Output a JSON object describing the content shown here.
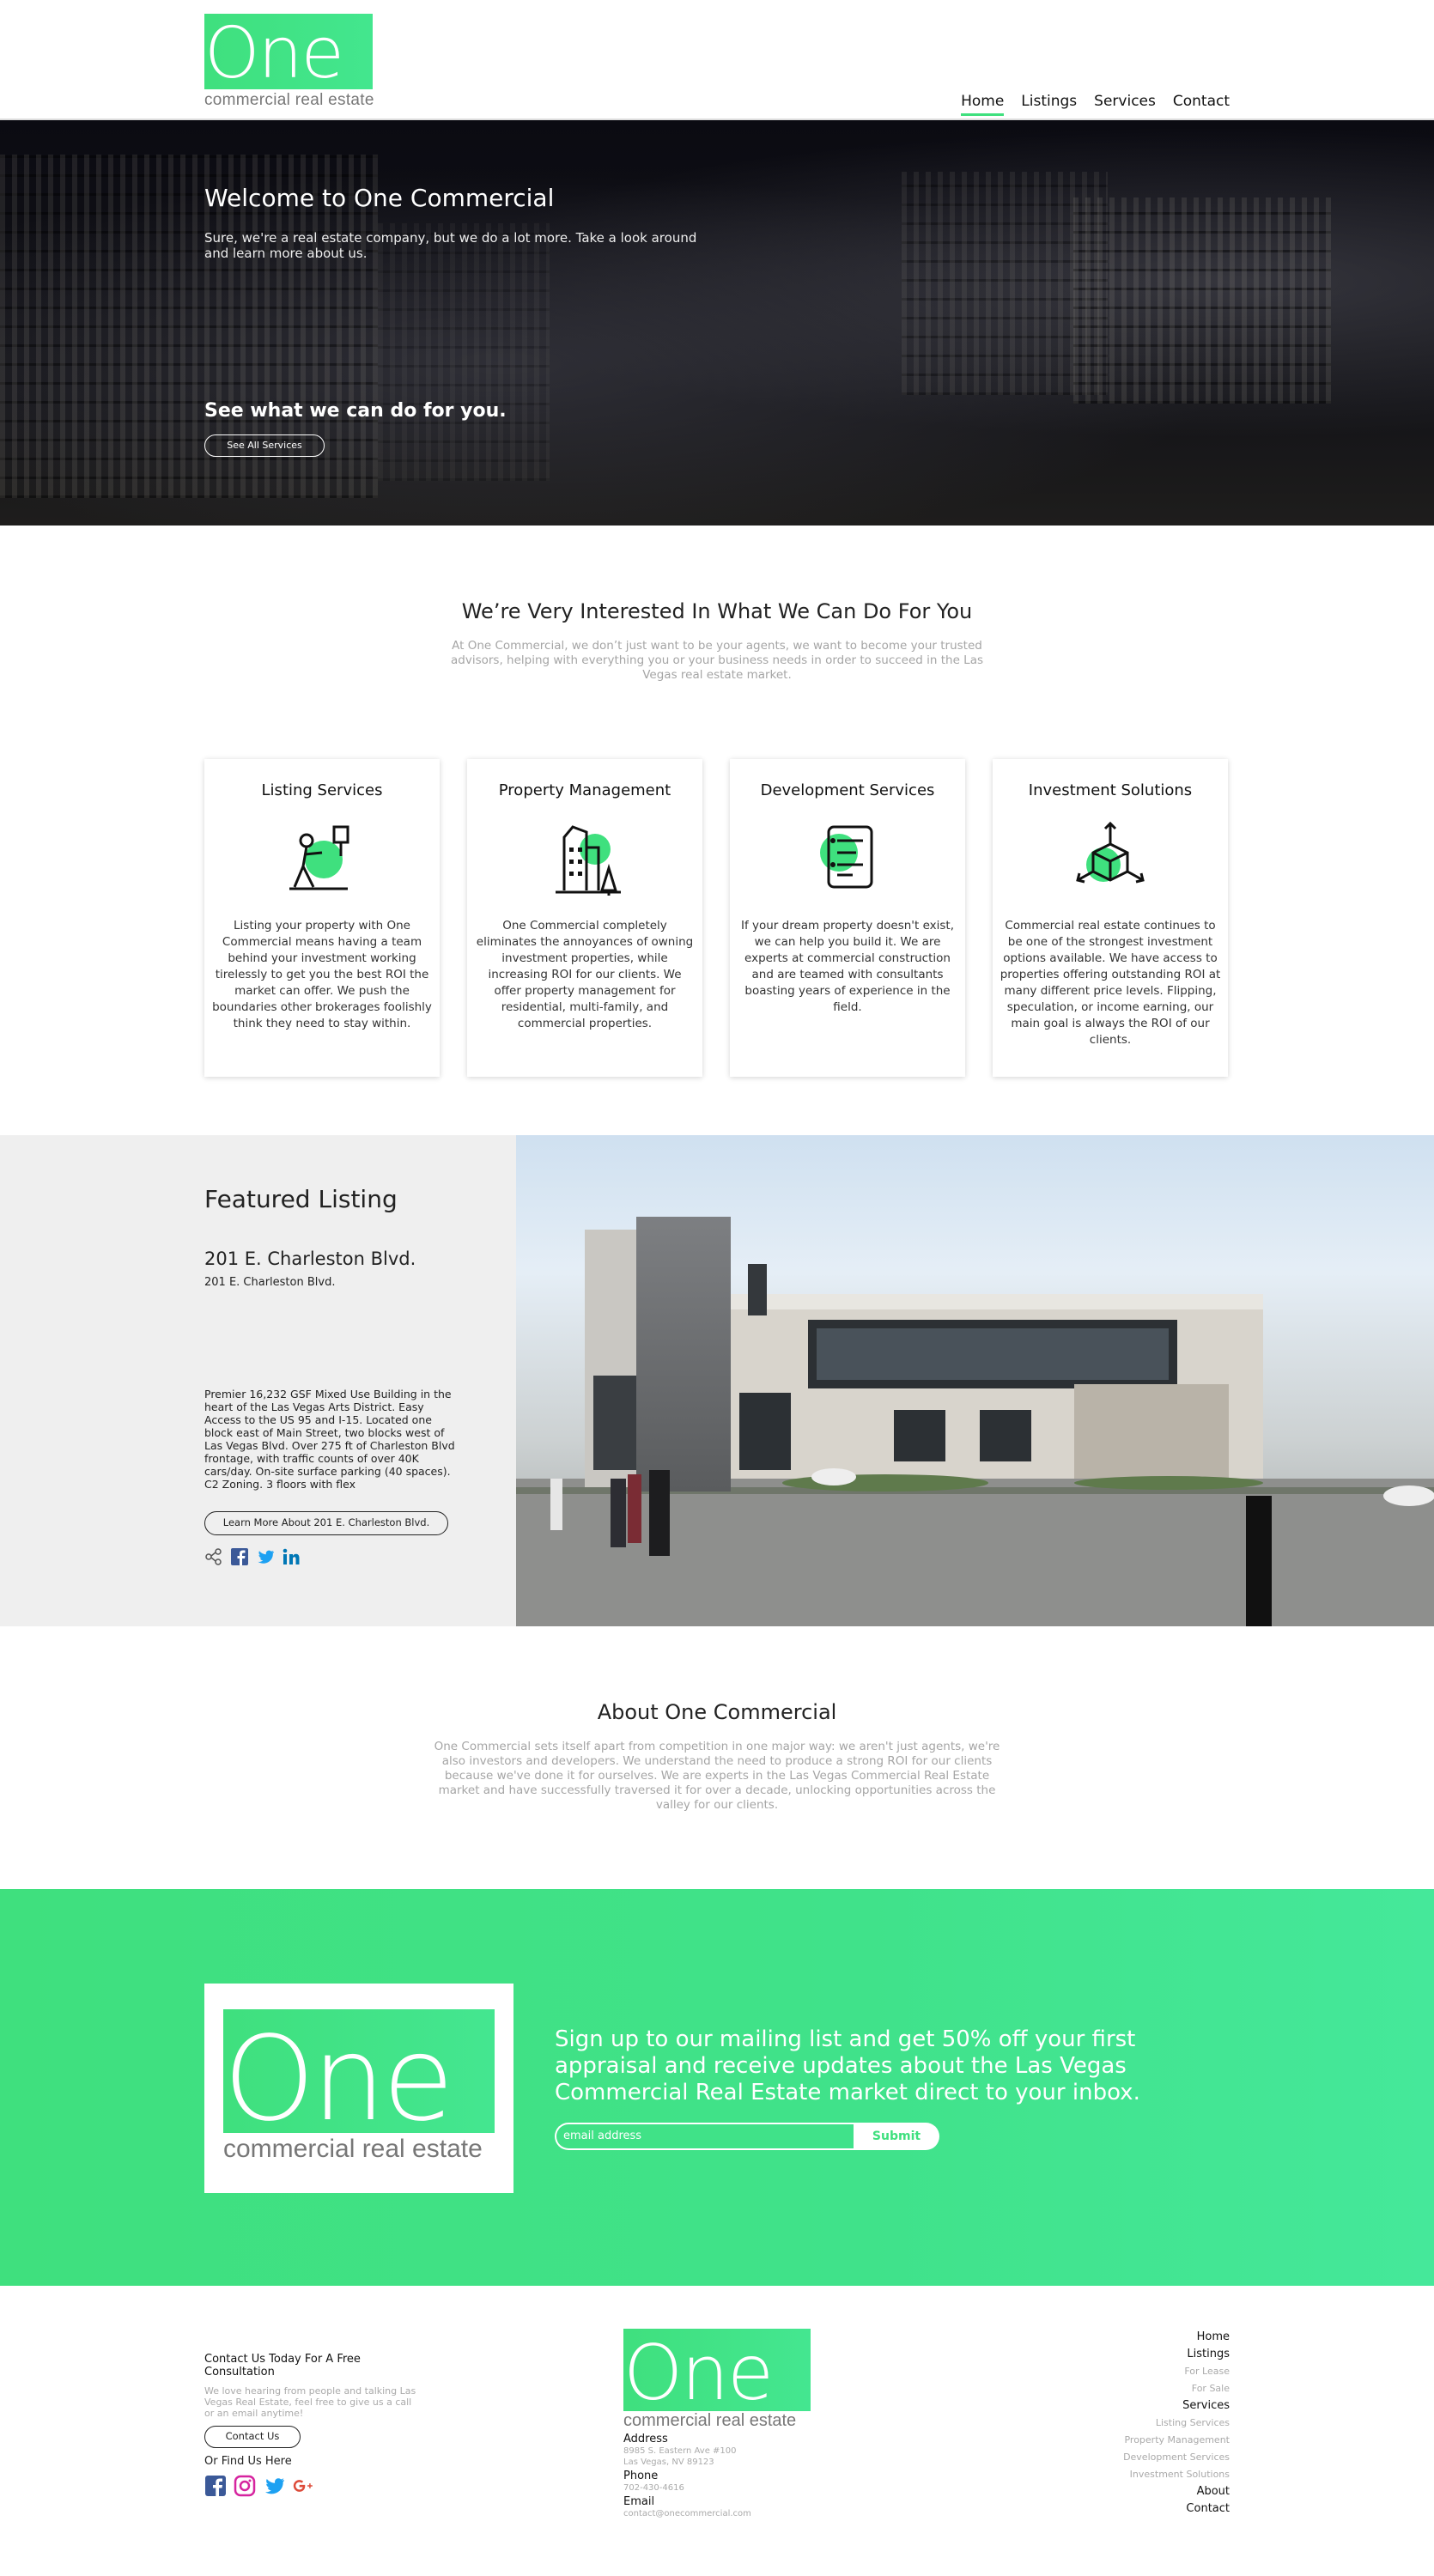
{
  "brand": {
    "logo_word": "One",
    "logo_tagline": "commercial real estate",
    "accent_color": "#3fe07e"
  },
  "nav": {
    "items": [
      {
        "label": "Home",
        "active": true
      },
      {
        "label": "Listings"
      },
      {
        "label": "Services"
      },
      {
        "label": "Contact"
      }
    ]
  },
  "hero": {
    "title": "Welcome to One Commercial",
    "text": "Sure, we're a real estate company, but we do a lot more. Take a look around and learn more about us.",
    "cta_heading": "See what we can do for you.",
    "cta_button": "See All Services"
  },
  "intro": {
    "title": "We’re Very Interested In What We Can Do For You",
    "text": "At One Commercial, we don’t just want to be your agents, we want to become your trusted advisors, helping with everything you or your business needs in order to succeed in the Las Vegas real estate market."
  },
  "services": [
    {
      "title": "Listing Services",
      "icon": "person-with-sign-icon",
      "text": "Listing your property with One Commercial means having a team behind your investment working tirelessly to get you the best ROI the market can offer. We push the boundaries other brokerages foolishly think they need to stay within."
    },
    {
      "title": "Property Management",
      "icon": "building-tree-icon",
      "text": "One Commercial completely eliminates the annoyances of owning investment properties, while increasing ROI for our clients. We offer property management for residential, multi-family, and commercial properties."
    },
    {
      "title": "Development Services",
      "icon": "blueprint-icon",
      "text": "If your dream property doesn't exist, we can help you build it. We are experts at commercial construction and are teamed with consultants boasting years of experience in the field."
    },
    {
      "title": "Investment Solutions",
      "icon": "cube-arrows-icon",
      "text": "Commercial real estate continues to be one of the strongest investment options available. We have access to properties offering outstanding ROI at many different price levels. Flipping, speculation, or income earning, our main goal is always the ROI of our clients."
    }
  ],
  "featured": {
    "heading": "Featured Listing",
    "name": "201 E. Charleston Blvd.",
    "address": "201 E. Charleston Blvd.",
    "description": "Premier 16,232 GSF Mixed Use Building in the heart of the Las Vegas Arts District.  Easy Access to the US 95 and I-15.  Located one block east of Main Street, two blocks west of Las Vegas Blvd. Over 275 ft of Charleston Blvd frontage, with traffic counts of over 40K cars/day.  On-site surface parking (40 spaces).  C2 Zoning.  3 floors with flex",
    "button": "Learn More About 201 E. Charleston Blvd."
  },
  "about": {
    "title": "About One Commercial",
    "text": "One Commercial sets itself apart from competition in one major way: we aren't just agents, we're also investors and developers. We understand the need to produce a strong ROI for our clients because we've done it for ourselves. We are experts in the Las Vegas Commercial Real Estate market and have successfully traversed it for over a decade, unlocking opportunities across the valley for our clients."
  },
  "signup": {
    "heading": "Sign up to our mailing list and get 50% off your first appraisal and receive updates about the Las Vegas Commercial Real Estate market direct to your inbox.",
    "email_placeholder": "email address",
    "submit": "Submit"
  },
  "footer": {
    "contact_title": "Contact Us Today For A Free Consultation",
    "contact_text": "We love hearing from people and talking Las Vegas Real Estate, feel free to give us a call or an email anytime!",
    "contact_button": "Contact Us",
    "find_us": "Or Find Us Here",
    "address_label": "Address",
    "address_line1": "8985 S. Eastern Ave #100",
    "address_line2": "Las Vegas, NV 89123",
    "phone_label": "Phone",
    "phone": "702-430-4616",
    "email_label": "Email",
    "email": "contact@onecommercial.com",
    "links": [
      {
        "label": "Home",
        "main": true
      },
      {
        "label": "Listings",
        "main": true
      },
      {
        "label": "For Lease",
        "main": false
      },
      {
        "label": "For Sale",
        "main": false
      },
      {
        "label": "Services",
        "main": true
      },
      {
        "label": "Listing Services",
        "main": false
      },
      {
        "label": "Property Management",
        "main": false
      },
      {
        "label": "Development Services",
        "main": false
      },
      {
        "label": "Investment Solutions",
        "main": false
      },
      {
        "label": "About",
        "main": true
      },
      {
        "label": "Contact",
        "main": true
      }
    ]
  }
}
